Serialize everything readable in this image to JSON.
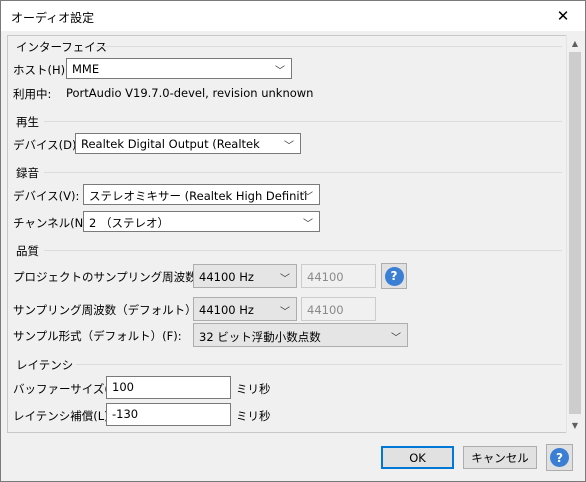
{
  "window": {
    "title": "オーディオ設定",
    "close_glyph": "✕"
  },
  "interface": {
    "section_title": "インターフェイス",
    "host_label": "ホスト(H):",
    "host_value": "MME",
    "using_label": "利用中:",
    "using_value": "PortAudio V19.7.0-devel, revision unknown"
  },
  "playback": {
    "section_title": "再生",
    "device_label": "デバイス(D):",
    "device_value": "Realtek Digital Output (Realtek"
  },
  "recording": {
    "section_title": "録音",
    "device_label": "デバイス(V):",
    "device_value": "ステレオミキサー (Realtek High Definiti",
    "channels_label": "チャンネル(N):",
    "channels_value": "2 （ステレオ）"
  },
  "quality": {
    "section_title": "品質",
    "project_rate_label": "プロジェクトのサンプリング周波数 (P):",
    "project_rate_value": "44100 Hz",
    "project_rate_custom": "44100",
    "default_rate_label": "サンプリング周波数（デフォルト）(E):",
    "default_rate_value": "44100 Hz",
    "default_rate_custom": "44100",
    "sample_format_label": "サンプル形式（デフォルト）(F):",
    "sample_format_value": "32 ビット浮動小数点数"
  },
  "latency": {
    "section_title": "レイテンシ",
    "buffer_label": "バッファーサイズ(B):",
    "buffer_value": "100",
    "buffer_unit": "ミリ秒",
    "compensation_label": "レイテンシ補償(L):",
    "compensation_value": "-130",
    "compensation_unit": "ミリ秒"
  },
  "buttons": {
    "ok": "OK",
    "cancel": "キャンセル",
    "help_glyph": "?"
  },
  "icons": {
    "dropdown_arrow": "chevron-down-icon",
    "help": "help-icon",
    "close": "close-icon"
  },
  "colors": {
    "accent": "#0078d7",
    "help_blue": "#3b7fd4"
  }
}
